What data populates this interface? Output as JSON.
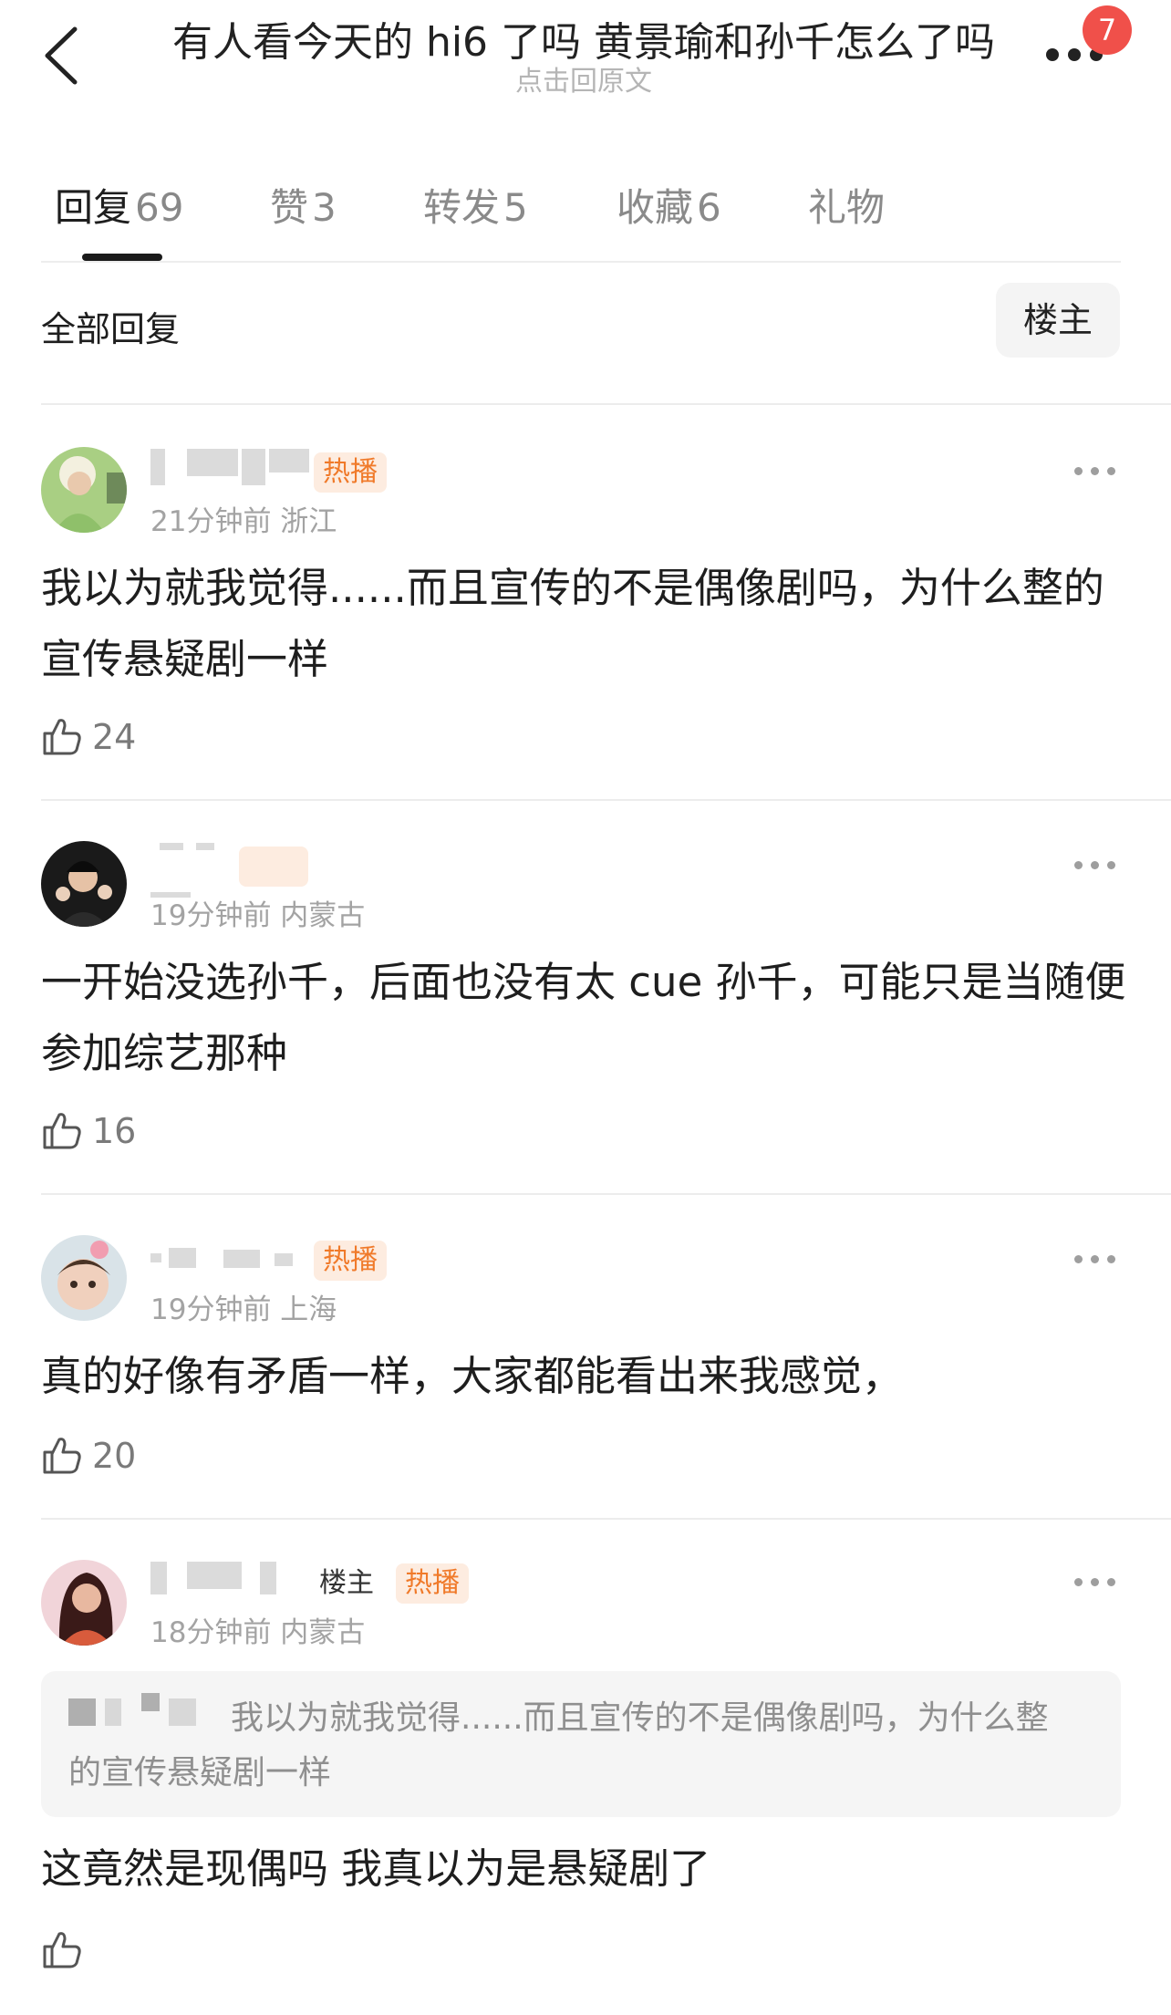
{
  "header": {
    "title": "有人看今天的 hi6 了吗  黄景瑜和孙千怎么了吗",
    "subtitle": "点击回原文",
    "notification_badge": "7"
  },
  "tabs": [
    {
      "label": "回复",
      "count": "69",
      "active": true
    },
    {
      "label": "赞",
      "count": "3",
      "active": false
    },
    {
      "label": "转发",
      "count": "5",
      "active": false
    },
    {
      "label": "收藏",
      "count": "6",
      "active": false
    },
    {
      "label": "礼物",
      "count": "",
      "active": false
    }
  ],
  "filter": {
    "title": "全部回复",
    "op_button": "楼主"
  },
  "comments": [
    {
      "tag": "热播",
      "meta": "21分钟前 浙江",
      "text": "我以为就我觉得......而且宣传的不是偶像剧吗，为什么整的宣传悬疑剧一样",
      "likes": "24"
    },
    {
      "tag": "",
      "meta": "19分钟前 内蒙古",
      "text": "一开始没选孙千，后面也没有太 cue 孙千，可能只是当随便参加综艺那种",
      "likes": "16"
    },
    {
      "tag": "热播",
      "meta": "19分钟前 上海",
      "text": "真的好像有矛盾一样，大家都能看出来我感觉，",
      "likes": "20"
    },
    {
      "op_label": "楼主",
      "tag": "热播",
      "meta": "18分钟前 内蒙古",
      "quote_line1": "我以为就我觉得......而且宣传的不是偶像剧吗，为什么整",
      "quote_line2": "的宣传悬疑剧一样",
      "text": "这竟然是现偶吗  我真以为是悬疑剧了",
      "likes": ""
    }
  ],
  "icons": {
    "back": "chevron-left-icon",
    "more": "more-dots-icon",
    "like": "thumbs-up-icon"
  },
  "colors": {
    "tag_bg": "#fdece0",
    "tag_text": "#f07a2a",
    "badge": "#f0504a",
    "meta": "#a3a3a3"
  }
}
